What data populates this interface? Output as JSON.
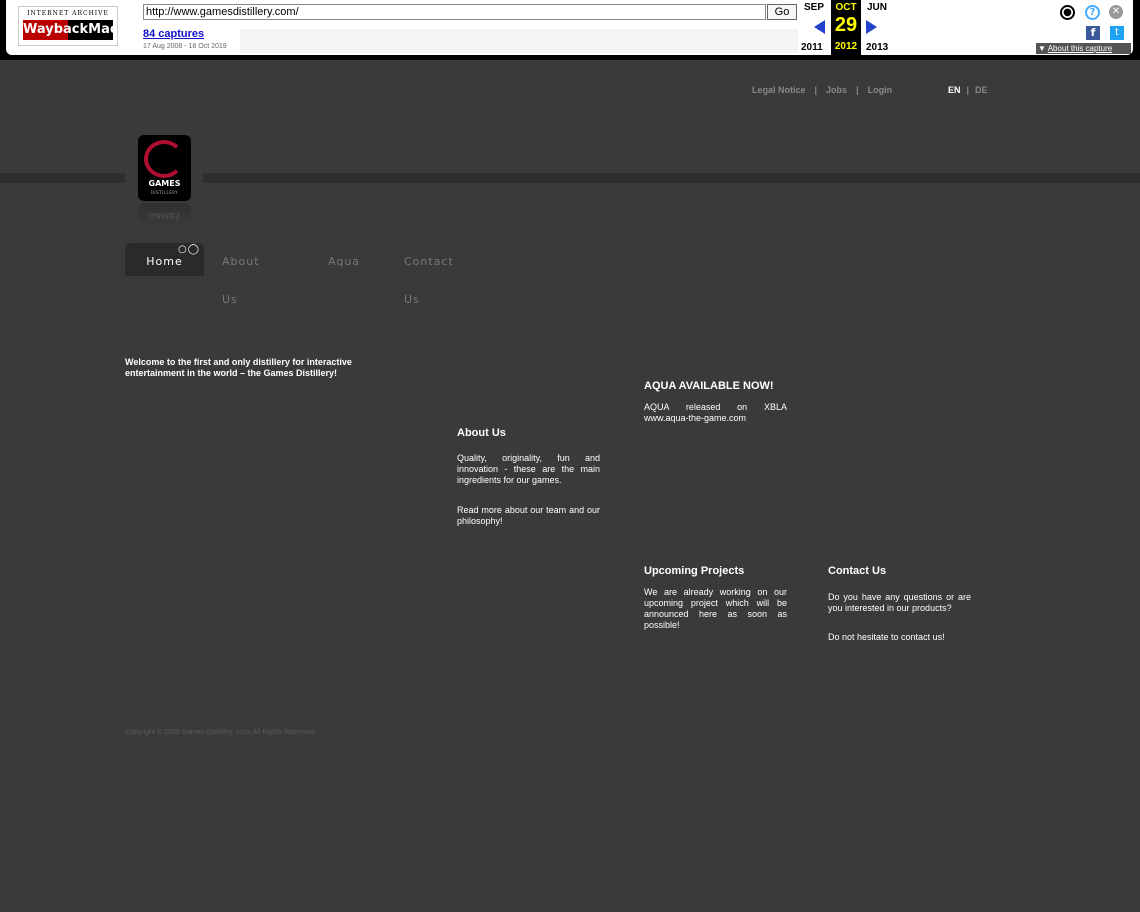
{
  "wayback": {
    "logo_top": "INTERNET ARCHIVE",
    "logo_bottom": "WaybackMachine",
    "url": "http://www.gamesdistillery.com/",
    "go_label": "Go",
    "captures_label": "84 captures",
    "date_range": "17 Aug 2008 - 18 Oct 2019",
    "prev_month": "SEP",
    "current_month": "OCT",
    "next_month": "JUN",
    "current_day": "29",
    "prev_year": "2011",
    "current_year": "2012",
    "next_year": "2013",
    "about_capture": "About this capture"
  },
  "site": {
    "top_nav": [
      "Legal Notice",
      "Jobs",
      "Login"
    ],
    "lang_en": "EN",
    "lang_de": "DE",
    "logo_text": "GAMES",
    "logo_sub": "DISTILLERY",
    "main_nav": [
      "Home",
      "About Us",
      "Aqua",
      "Contact Us"
    ],
    "welcome": "Welcome to the first and only distillery for interactive entertainment in the world – the Games Distillery!",
    "aqua_heading": "AQUA AVAILABLE NOW!",
    "aqua_text": "AQUA released on XBLA www.aqua-the-game.com",
    "about_heading": "About Us",
    "about_text1": "Quality, originality, fun and innovation - these are the main ingredients for our games.",
    "about_text2": "Read more about our team and our philosophy!",
    "upcoming_heading": "Upcoming Projects",
    "upcoming_text": "We are already working on our upcoming project which will be announced here as soon as possible!",
    "contact_heading": "Contact Us",
    "contact_text1": "Do you have any questions or are you interested in our products?",
    "contact_text2": "Do not hesitate to contact us!",
    "copyright": "Copyright © 2009 Games Distillery, s.r.o. All Rights Reserved"
  }
}
